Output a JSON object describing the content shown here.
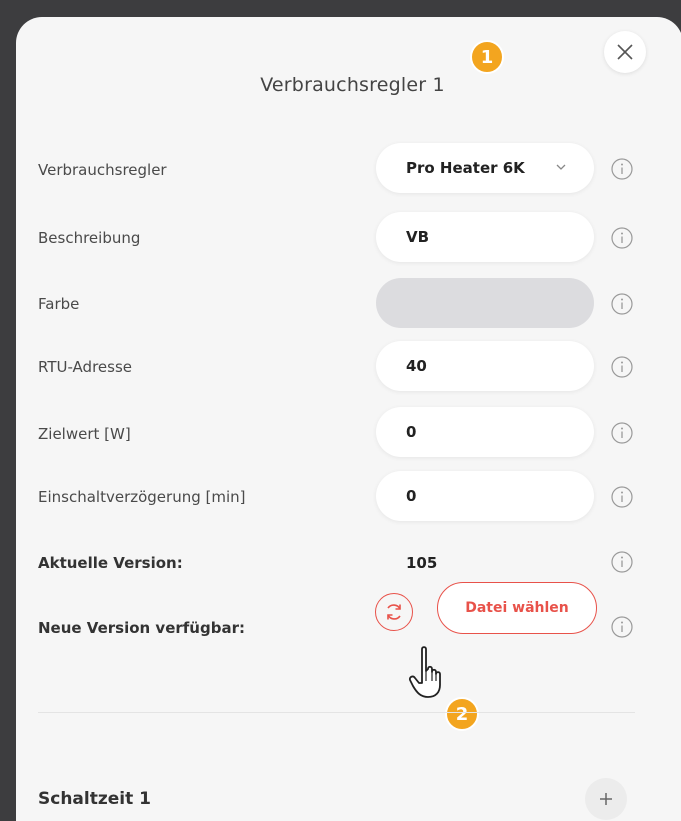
{
  "dialog": {
    "title": "Verbrauchsregler 1"
  },
  "fields": {
    "verbrauchsregler": {
      "label": "Verbrauchsregler",
      "value": "Pro Heater 6K"
    },
    "beschreibung": {
      "label": "Beschreibung",
      "value": "VB"
    },
    "farbe": {
      "label": "Farbe",
      "value": "",
      "color": "#dcdcdf"
    },
    "rtu": {
      "label": "RTU-Adresse",
      "value": "40"
    },
    "zielwert": {
      "label": "Zielwert [W]",
      "value": "0"
    },
    "einschalt": {
      "label": "Einschaltverzögerung [min]",
      "value": "0"
    },
    "version": {
      "label": "Aktuelle Version:",
      "value": "105"
    },
    "neue_version": {
      "label": "Neue Version verfügbar:",
      "file_button": "Datei wählen"
    }
  },
  "section": {
    "title": "Schaltzeit 1"
  },
  "badges": {
    "one": "1",
    "two": "2"
  },
  "colors": {
    "accent": "#e8524a",
    "badge": "#f3a51f"
  },
  "icons": [
    "close-icon",
    "chevron-down-icon",
    "info-icon",
    "refresh-icon",
    "plus-icon",
    "hand-cursor-icon"
  ]
}
